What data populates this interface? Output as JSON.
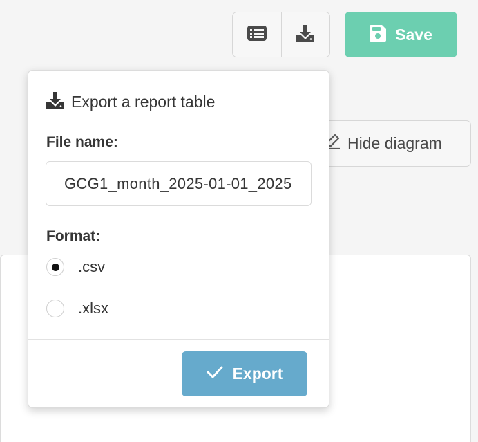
{
  "toolbar": {
    "list_icon": "list-icon",
    "download_icon": "download-icon",
    "save_label": "Save",
    "save_icon": "floppy-disk-icon"
  },
  "diagram": {
    "hide_label": "Hide diagram",
    "hide_icon": "pencil-icon"
  },
  "export_popover": {
    "title": "Export a report table",
    "title_icon": "download-icon",
    "file_name_label": "File name:",
    "file_name_value": "GCG1_month_2025-01-01_2025",
    "format_label": "Format:",
    "formats": [
      {
        "label": ".csv",
        "selected": true
      },
      {
        "label": ".xlsx",
        "selected": false
      }
    ],
    "export_label": "Export",
    "export_icon": "checkmark-icon"
  },
  "colors": {
    "save_button": "#6ccfb0",
    "export_button": "#66aacc",
    "background": "#f5f5f5"
  }
}
